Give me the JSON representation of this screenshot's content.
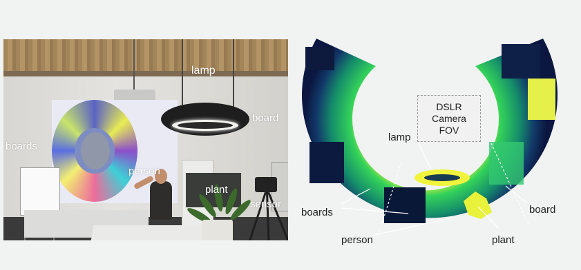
{
  "photo": {
    "labels": {
      "lamp": "lamp",
      "board": "board",
      "boards": "boards",
      "person": "person",
      "plant": "plant",
      "sensor": "sensor"
    }
  },
  "scan": {
    "labels": {
      "lamp": "lamp",
      "boards": "boards",
      "person": "person",
      "board": "board",
      "plant": "plant"
    },
    "fov_box": {
      "line1": "DSLR",
      "line2": "Camera",
      "line3": "FOV"
    }
  },
  "colors": {
    "background": "#f1f2f2",
    "scan_dark": "#0c1c4a",
    "scan_green": "#2fd155",
    "scan_yellow": "#e9f23a",
    "label_dark": "#222222",
    "label_light": "#ffffff"
  }
}
